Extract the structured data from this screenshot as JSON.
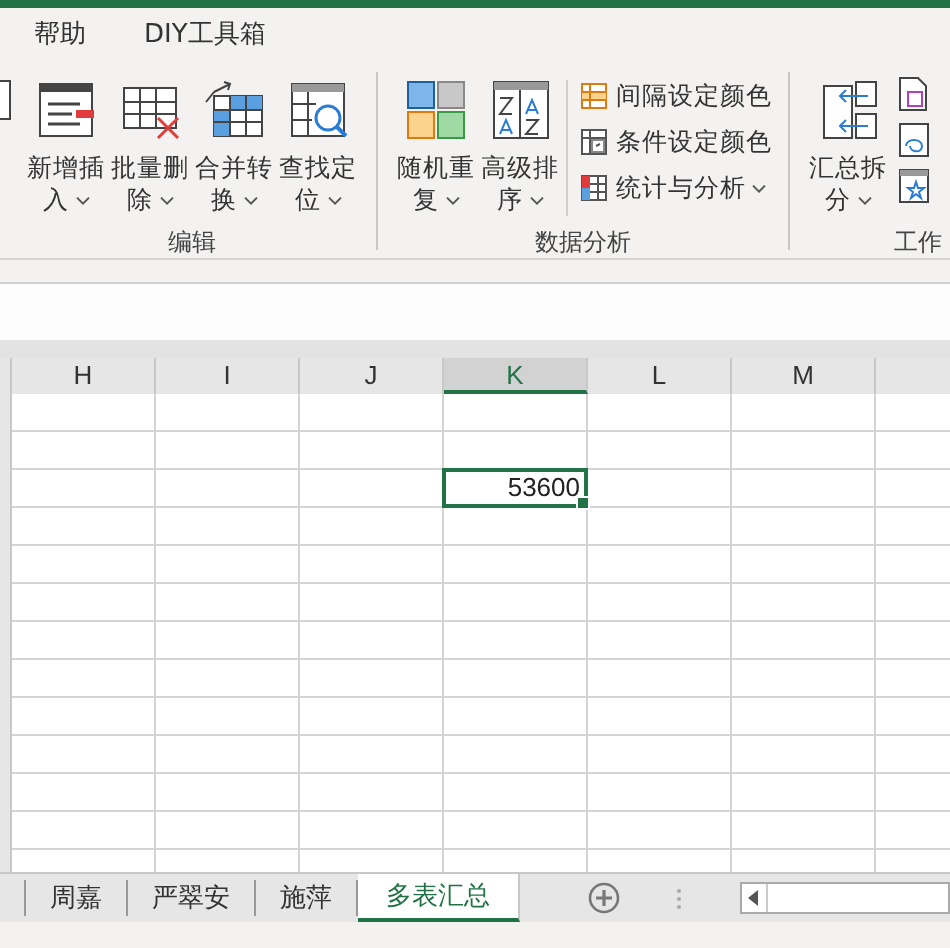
{
  "menu_tabs": [
    {
      "label": "帮助",
      "selected": false
    },
    {
      "label": "DIY工具箱",
      "selected": false
    }
  ],
  "ribbon": {
    "groups": [
      {
        "label": "编辑",
        "items": [
          {
            "kind": "large",
            "lines": [
              "新增插",
              "入"
            ],
            "dropdown": true
          },
          {
            "kind": "large",
            "lines": [
              "批量删",
              "除"
            ],
            "dropdown": true
          },
          {
            "kind": "large",
            "lines": [
              "合并转",
              "换"
            ],
            "dropdown": true
          },
          {
            "kind": "large",
            "lines": [
              "查找定",
              "位"
            ],
            "dropdown": true
          }
        ]
      },
      {
        "label": "数据分析",
        "items": [
          {
            "kind": "large",
            "lines": [
              "随机重",
              "复"
            ],
            "dropdown": true
          },
          {
            "kind": "large",
            "lines": [
              "高级排",
              "序"
            ],
            "dropdown": true
          },
          {
            "kind": "small",
            "lines": [
              "间隔设定颜色"
            ],
            "dropdown": false
          },
          {
            "kind": "small",
            "lines": [
              "条件设定颜色"
            ],
            "dropdown": false
          },
          {
            "kind": "small",
            "lines": [
              "统计与分析"
            ],
            "dropdown": true
          }
        ]
      },
      {
        "label": "工作",
        "items": [
          {
            "kind": "large",
            "lines": [
              "汇总拆",
              "分"
            ],
            "dropdown": true
          },
          {
            "kind": "icons"
          }
        ]
      }
    ]
  },
  "columns": [
    {
      "label": "H",
      "selected": false
    },
    {
      "label": "I",
      "selected": false
    },
    {
      "label": "J",
      "selected": false
    },
    {
      "label": "K",
      "selected": true
    },
    {
      "label": "L",
      "selected": false
    },
    {
      "label": "M",
      "selected": false
    }
  ],
  "rows": [
    {
      "cells": [
        null,
        null,
        null,
        null,
        null,
        null
      ]
    },
    {
      "cells": [
        null,
        null,
        null,
        null,
        null,
        null
      ]
    },
    {
      "cells": [
        null,
        null,
        null,
        {
          "value": "53600",
          "selected": true
        },
        null,
        null
      ]
    }
  ],
  "sheet_tabs": [
    {
      "label": "周嘉",
      "selected": false
    },
    {
      "label": "严翠安",
      "selected": false
    },
    {
      "label": "施萍",
      "selected": false
    },
    {
      "label": "多表汇总",
      "selected": true
    }
  ]
}
